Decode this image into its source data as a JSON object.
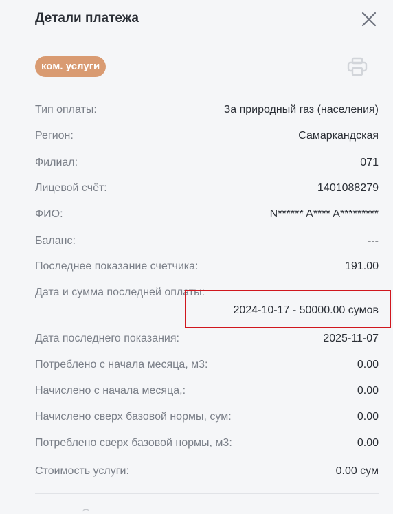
{
  "header": {
    "title": "Детали платежа",
    "close_icon": "close-icon"
  },
  "badge": {
    "label": "ком. услуги",
    "color": "#d99b72"
  },
  "print": {
    "icon": "printer-icon"
  },
  "details": [
    {
      "label": "Тип оплаты:",
      "value": "За природный газ (населения)"
    },
    {
      "label": "Регион:",
      "value": "Самаркандская"
    },
    {
      "label": "Филиал:",
      "value": "071"
    },
    {
      "label": "Лицевой счёт:",
      "value": "1401088279"
    },
    {
      "label": "ФИО:",
      "value": "N****** A**** A*********"
    },
    {
      "label": "Баланс:",
      "value": "---"
    },
    {
      "label": "Последнее показание счетчика:",
      "value": "191.00"
    },
    {
      "label": "Дата и сумма последней оплаты:",
      "value": "2024-10-17 - 50000.00 сумов"
    },
    {
      "label": "Дата последнего показания:",
      "value": "2025-11-07"
    },
    {
      "label": "Потреблено с начала месяца, м3:",
      "value": "0.00"
    },
    {
      "label": "Начислено с начала месяца,:",
      "value": "0.00"
    },
    {
      "label": "Начислено сверх базовой нормы, сум:",
      "value": "0.00"
    },
    {
      "label": "Потреблено сверх базовой нормы, м3:",
      "value": "0.00"
    },
    {
      "label": "Стоимость услуги:",
      "value": "0.00 сум"
    }
  ],
  "colors": {
    "highlight_border": "#d0171e",
    "label": "#7a7f88",
    "value": "#2b2f36"
  }
}
